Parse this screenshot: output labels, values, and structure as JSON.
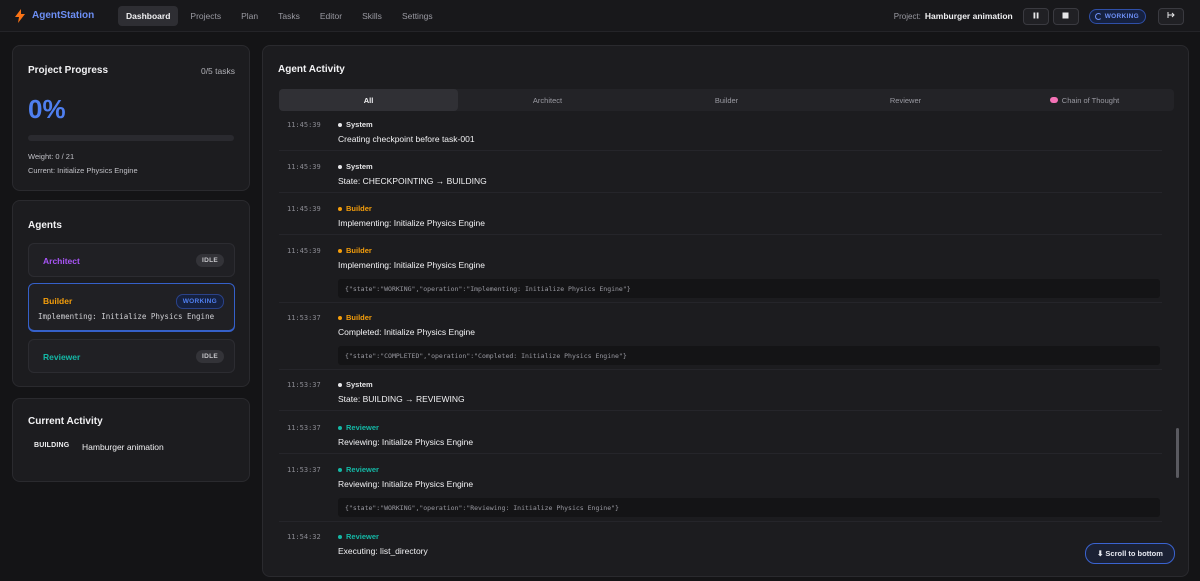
{
  "app": {
    "name": "AgentStation",
    "icon": "lightning-icon"
  },
  "nav": {
    "items": [
      "Dashboard",
      "Projects",
      "Plan",
      "Tasks",
      "Editor",
      "Skills",
      "Settings"
    ],
    "active": "Dashboard"
  },
  "header": {
    "project_label": "Project:",
    "project_name": "Hamburger animation",
    "pause_icon": "pause-icon",
    "stop_icon": "stop-icon",
    "status": "WORKING",
    "logout_icon": "logout-icon"
  },
  "progress": {
    "title": "Project Progress",
    "tasks": "0/5 tasks",
    "percent_text": "0%",
    "fraction": 0.0,
    "weight": "Weight: 0 / 21",
    "current": "Current: Initialize Physics Engine"
  },
  "agents": {
    "title": "Agents",
    "items": [
      {
        "name": "Architect",
        "status": "IDLE",
        "color": "#a855f7",
        "task": ""
      },
      {
        "name": "Builder",
        "status": "WORKING",
        "color": "#f59e0b",
        "task": "Implementing: Initialize Physics Engine"
      },
      {
        "name": "Reviewer",
        "status": "IDLE",
        "color": "#14b8a6",
        "task": ""
      }
    ]
  },
  "current_activity": {
    "title": "Current Activity",
    "state": "BUILDING",
    "project": "Hamburger animation"
  },
  "activity": {
    "title": "Agent Activity",
    "tabs": [
      "All",
      "Architect",
      "Builder",
      "Reviewer",
      "Chain of Thought"
    ],
    "active_tab": "All",
    "colors": {
      "System": "#e6e6e8",
      "Builder": "#f59e0b",
      "Reviewer": "#14b8a6"
    },
    "entries": [
      {
        "time": "11:45:39",
        "role": "System",
        "message": "Creating checkpoint before task-001",
        "detail": ""
      },
      {
        "time": "11:45:39",
        "role": "System",
        "message": "State: CHECKPOINTING → BUILDING",
        "detail": ""
      },
      {
        "time": "11:45:39",
        "role": "Builder",
        "message": "Implementing: Initialize Physics Engine",
        "detail": ""
      },
      {
        "time": "11:45:39",
        "role": "Builder",
        "message": "Implementing: Initialize Physics Engine",
        "detail": "{\"state\":\"WORKING\",\"operation\":\"Implementing: Initialize Physics Engine\"}"
      },
      {
        "time": "11:53:37",
        "role": "Builder",
        "message": "Completed: Initialize Physics Engine",
        "detail": "{\"state\":\"COMPLETED\",\"operation\":\"Completed: Initialize Physics Engine\"}"
      },
      {
        "time": "11:53:37",
        "role": "System",
        "message": "State: BUILDING → REVIEWING",
        "detail": ""
      },
      {
        "time": "11:53:37",
        "role": "Reviewer",
        "message": "Reviewing: Initialize Physics Engine",
        "detail": ""
      },
      {
        "time": "11:53:37",
        "role": "Reviewer",
        "message": "Reviewing: Initialize Physics Engine",
        "detail": "{\"state\":\"WORKING\",\"operation\":\"Reviewing: Initialize Physics Engine\"}"
      },
      {
        "time": "11:54:32",
        "role": "Reviewer",
        "message": "Executing: list_directory",
        "detail": ""
      }
    ],
    "scroll_button": "⬇ Scroll to bottom"
  }
}
